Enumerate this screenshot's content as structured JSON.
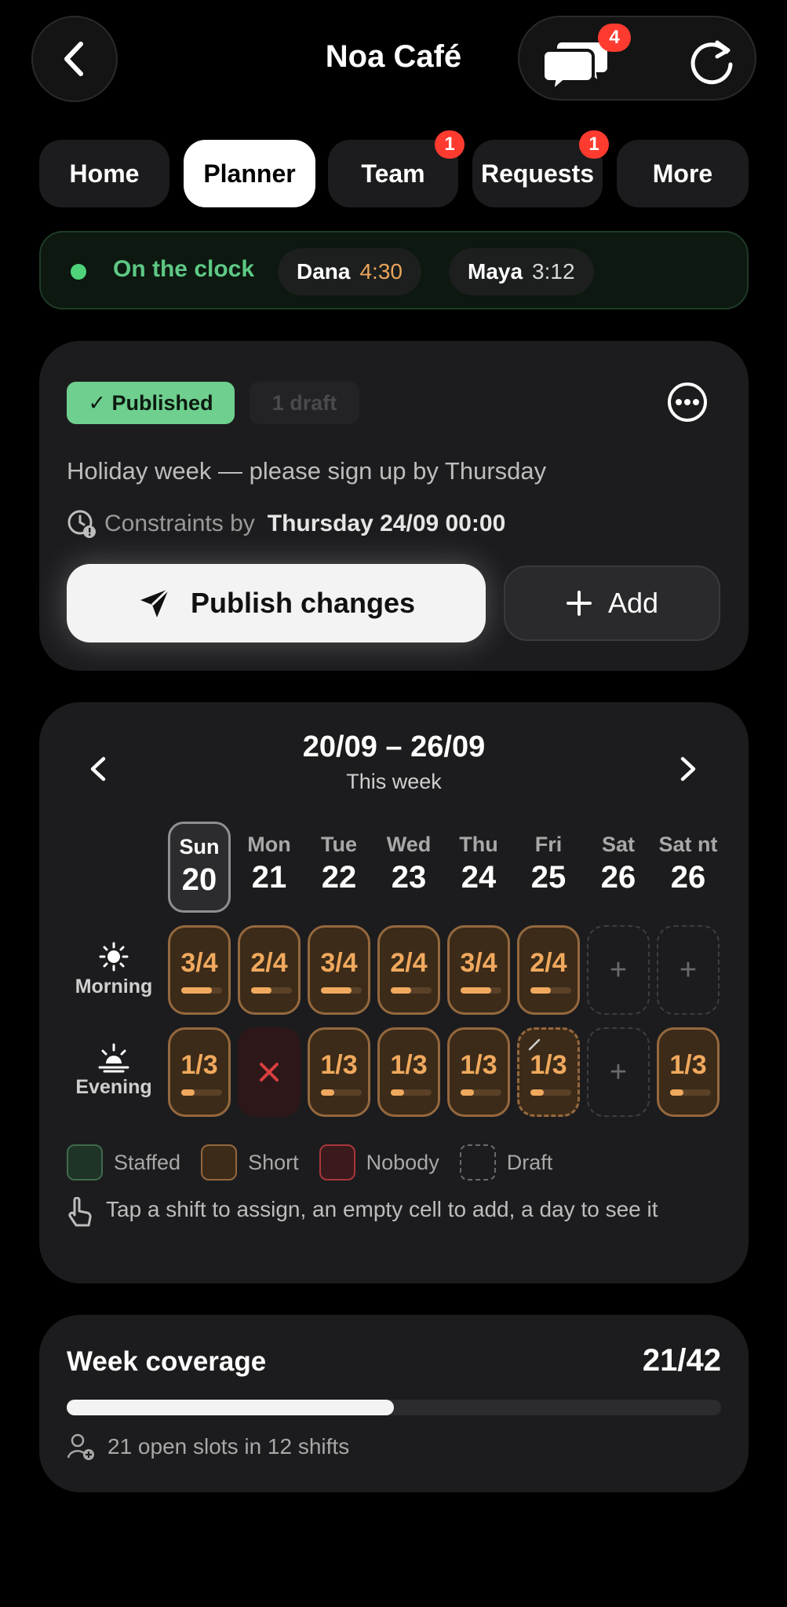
{
  "header": {
    "title": "Noa Café",
    "chat_badge": "4",
    "icons": {
      "back": "chevron-left-icon",
      "chat": "chat-bubbles-icon",
      "refresh": "refresh-icon"
    }
  },
  "tabs": [
    {
      "label": "Home",
      "badge": ""
    },
    {
      "label": "Planner",
      "badge": "",
      "active": true
    },
    {
      "label": "Team",
      "badge": "1"
    },
    {
      "label": "Requests",
      "badge": "1"
    },
    {
      "label": "More",
      "badge": ""
    }
  ],
  "clock": {
    "label": "On the clock",
    "people": [
      {
        "name": "Dana",
        "time": "4:30"
      },
      {
        "name": "Maya",
        "time": "3:12"
      }
    ]
  },
  "status": {
    "published": "✓ Published",
    "draft": "1 draft",
    "notice": "Holiday week — please sign up by Thursday",
    "constraints_label": "Constraints by",
    "constraints_value": "Thursday 24/09 00:00",
    "publish_button": "Publish changes",
    "add_button": "Add"
  },
  "planner": {
    "range": "20/09 – 26/09",
    "subtitle": "This week",
    "days": [
      {
        "name": "Sun",
        "num": "20",
        "selected": true
      },
      {
        "name": "Mon",
        "num": "21"
      },
      {
        "name": "Tue",
        "num": "22"
      },
      {
        "name": "Wed",
        "num": "23"
      },
      {
        "name": "Thu",
        "num": "24"
      },
      {
        "name": "Fri",
        "num": "25"
      },
      {
        "name": "Sat",
        "num": "26"
      },
      {
        "name": "Sat nt",
        "num": "26"
      }
    ],
    "rows": [
      {
        "label": "Morning",
        "cells": [
          {
            "kind": "short",
            "text": "3/4",
            "fill": 0.75
          },
          {
            "kind": "short",
            "text": "2/4",
            "fill": 0.5
          },
          {
            "kind": "short",
            "text": "3/4",
            "fill": 0.75
          },
          {
            "kind": "short",
            "text": "2/4",
            "fill": 0.5
          },
          {
            "kind": "short",
            "text": "3/4",
            "fill": 0.75
          },
          {
            "kind": "short",
            "text": "2/4",
            "fill": 0.5
          },
          {
            "kind": "empty",
            "text": "+"
          },
          {
            "kind": "empty",
            "text": "+"
          }
        ]
      },
      {
        "label": "Evening",
        "cells": [
          {
            "kind": "short",
            "text": "1/3",
            "fill": 0.333
          },
          {
            "kind": "nobody",
            "text": ""
          },
          {
            "kind": "short",
            "text": "1/3",
            "fill": 0.333
          },
          {
            "kind": "short",
            "text": "1/3",
            "fill": 0.333
          },
          {
            "kind": "short",
            "text": "1/3",
            "fill": 0.333
          },
          {
            "kind": "draft",
            "text": "1/3",
            "fill": 0.333
          },
          {
            "kind": "empty",
            "text": "+"
          },
          {
            "kind": "short",
            "text": "1/3",
            "fill": 0.333
          }
        ]
      }
    ],
    "legend": [
      "Staffed",
      "Short",
      "Nobody",
      "Draft"
    ],
    "hint": "Tap a shift to assign, an empty cell to add, a day to see it"
  },
  "coverage": {
    "title": "Week coverage",
    "value": "21/42",
    "fraction": 0.5,
    "note": "21 open slots in 12 shifts"
  },
  "colors": {
    "accent_green": "#6ecf8e",
    "short_orange": "#f0a95e",
    "badge_red": "#ff3b30",
    "nobody_red": "#d9403f"
  }
}
